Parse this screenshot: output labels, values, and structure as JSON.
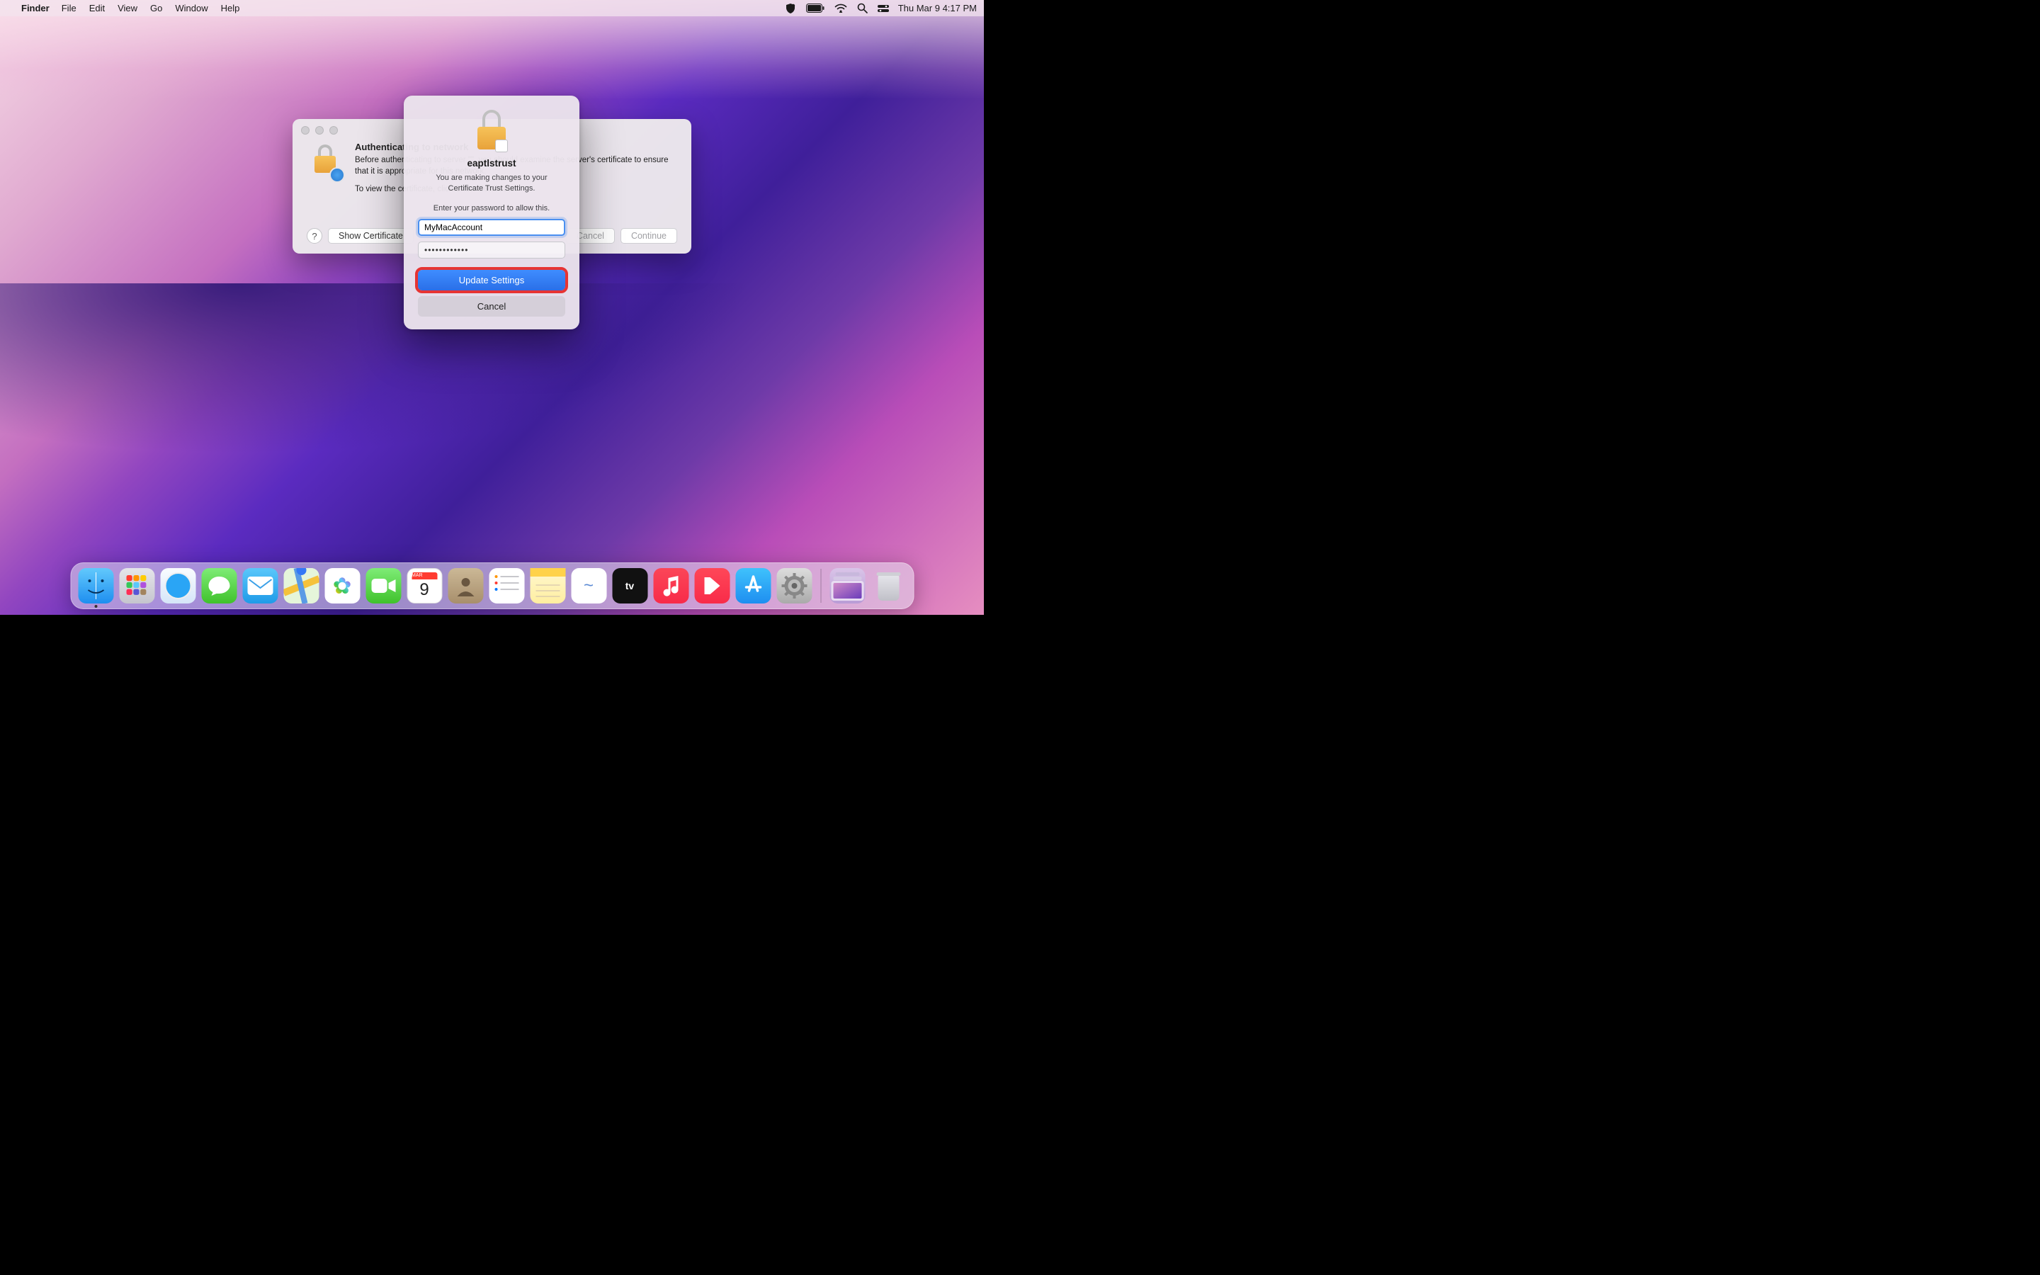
{
  "menubar": {
    "app": "Finder",
    "items": [
      "File",
      "Edit",
      "View",
      "Go",
      "Window",
      "Help"
    ],
    "datetime": "Thu Mar 9  4:17 PM"
  },
  "cert_window": {
    "title": "Authenticating to network",
    "p1": "Before authenticating to server \"\", you should examine the server's certificate to ensure that it is appropriate for this network.",
    "p2": "To view the certificate, click Show Certificate.",
    "show_cert_btn": "Show Certificate",
    "cancel_btn": "Cancel",
    "continue_btn": "Continue",
    "help_label": "?"
  },
  "cred_sheet": {
    "title": "eaptlstrust",
    "message": "You are making changes to your Certificate Trust Settings.",
    "prompt": "Enter your password to allow this.",
    "username_value": "MyMacAccount",
    "password_value": "••••••••••••",
    "update_btn": "Update Settings",
    "cancel_btn": "Cancel"
  },
  "dock": {
    "calendar_month": "MAR",
    "calendar_day": "9",
    "items": [
      {
        "name": "finder",
        "label": "Finder",
        "running": true
      },
      {
        "name": "launchpad",
        "label": "Launchpad"
      },
      {
        "name": "safari",
        "label": "Safari"
      },
      {
        "name": "messages",
        "label": "Messages"
      },
      {
        "name": "mail",
        "label": "Mail"
      },
      {
        "name": "maps",
        "label": "Maps"
      },
      {
        "name": "photos",
        "label": "Photos"
      },
      {
        "name": "facetime",
        "label": "FaceTime"
      },
      {
        "name": "calendar",
        "label": "Calendar"
      },
      {
        "name": "contacts",
        "label": "Contacts"
      },
      {
        "name": "reminders",
        "label": "Reminders"
      },
      {
        "name": "notes",
        "label": "Notes"
      },
      {
        "name": "freeform",
        "label": "Freeform"
      },
      {
        "name": "tv",
        "label": "TV"
      },
      {
        "name": "music",
        "label": "Music"
      },
      {
        "name": "news",
        "label": "News"
      },
      {
        "name": "appstore",
        "label": "App Store"
      },
      {
        "name": "settings",
        "label": "System Settings"
      }
    ]
  }
}
